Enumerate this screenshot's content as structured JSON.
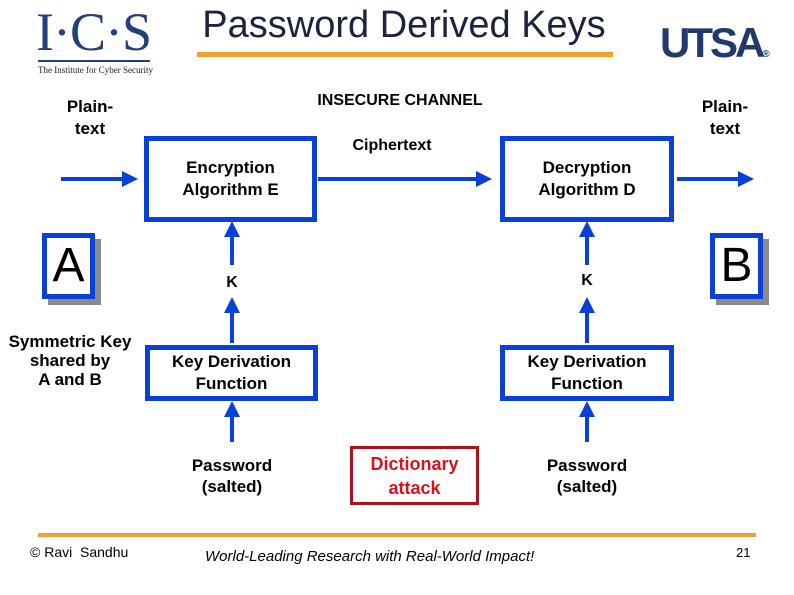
{
  "header": {
    "ics_logo": {
      "letters": "I·C·S",
      "subtitle": "The Institute for Cyber Security"
    },
    "title": "Password Derived Keys",
    "utsa_logo": {
      "text": "UTSA",
      "mark": "®"
    }
  },
  "diagram": {
    "channel_label": "INSECURE CHANNEL",
    "ciphertext_label": "Ciphertext",
    "plaintext_left": "Plain-\ntext",
    "plaintext_right": "Plain-\ntext",
    "encryption_box": "Encryption\nAlgorithm E",
    "decryption_box": "Decryption\nAlgorithm D",
    "party_a": "A",
    "party_b": "B",
    "key_left": "K",
    "key_right": "K",
    "shared_key_label": "Symmetric Key\nshared by\nA and B",
    "kdf_left": "Key Derivation\nFunction",
    "kdf_right": "Key Derivation\nFunction",
    "password_left": "Password\n(salted)",
    "password_right": "Password\n(salted)",
    "attack_label": "Dictionary\nattack"
  },
  "colors": {
    "arrow_blue": "#0a3fd8",
    "accent_orange": "#f0a030",
    "attack_red": "#d8131d",
    "title_navy": "#1b2340"
  },
  "footer": {
    "copyright": "© Ravi  Sandhu",
    "tagline": "World-Leading Research with Real-World Impact!",
    "page_number": "21"
  }
}
